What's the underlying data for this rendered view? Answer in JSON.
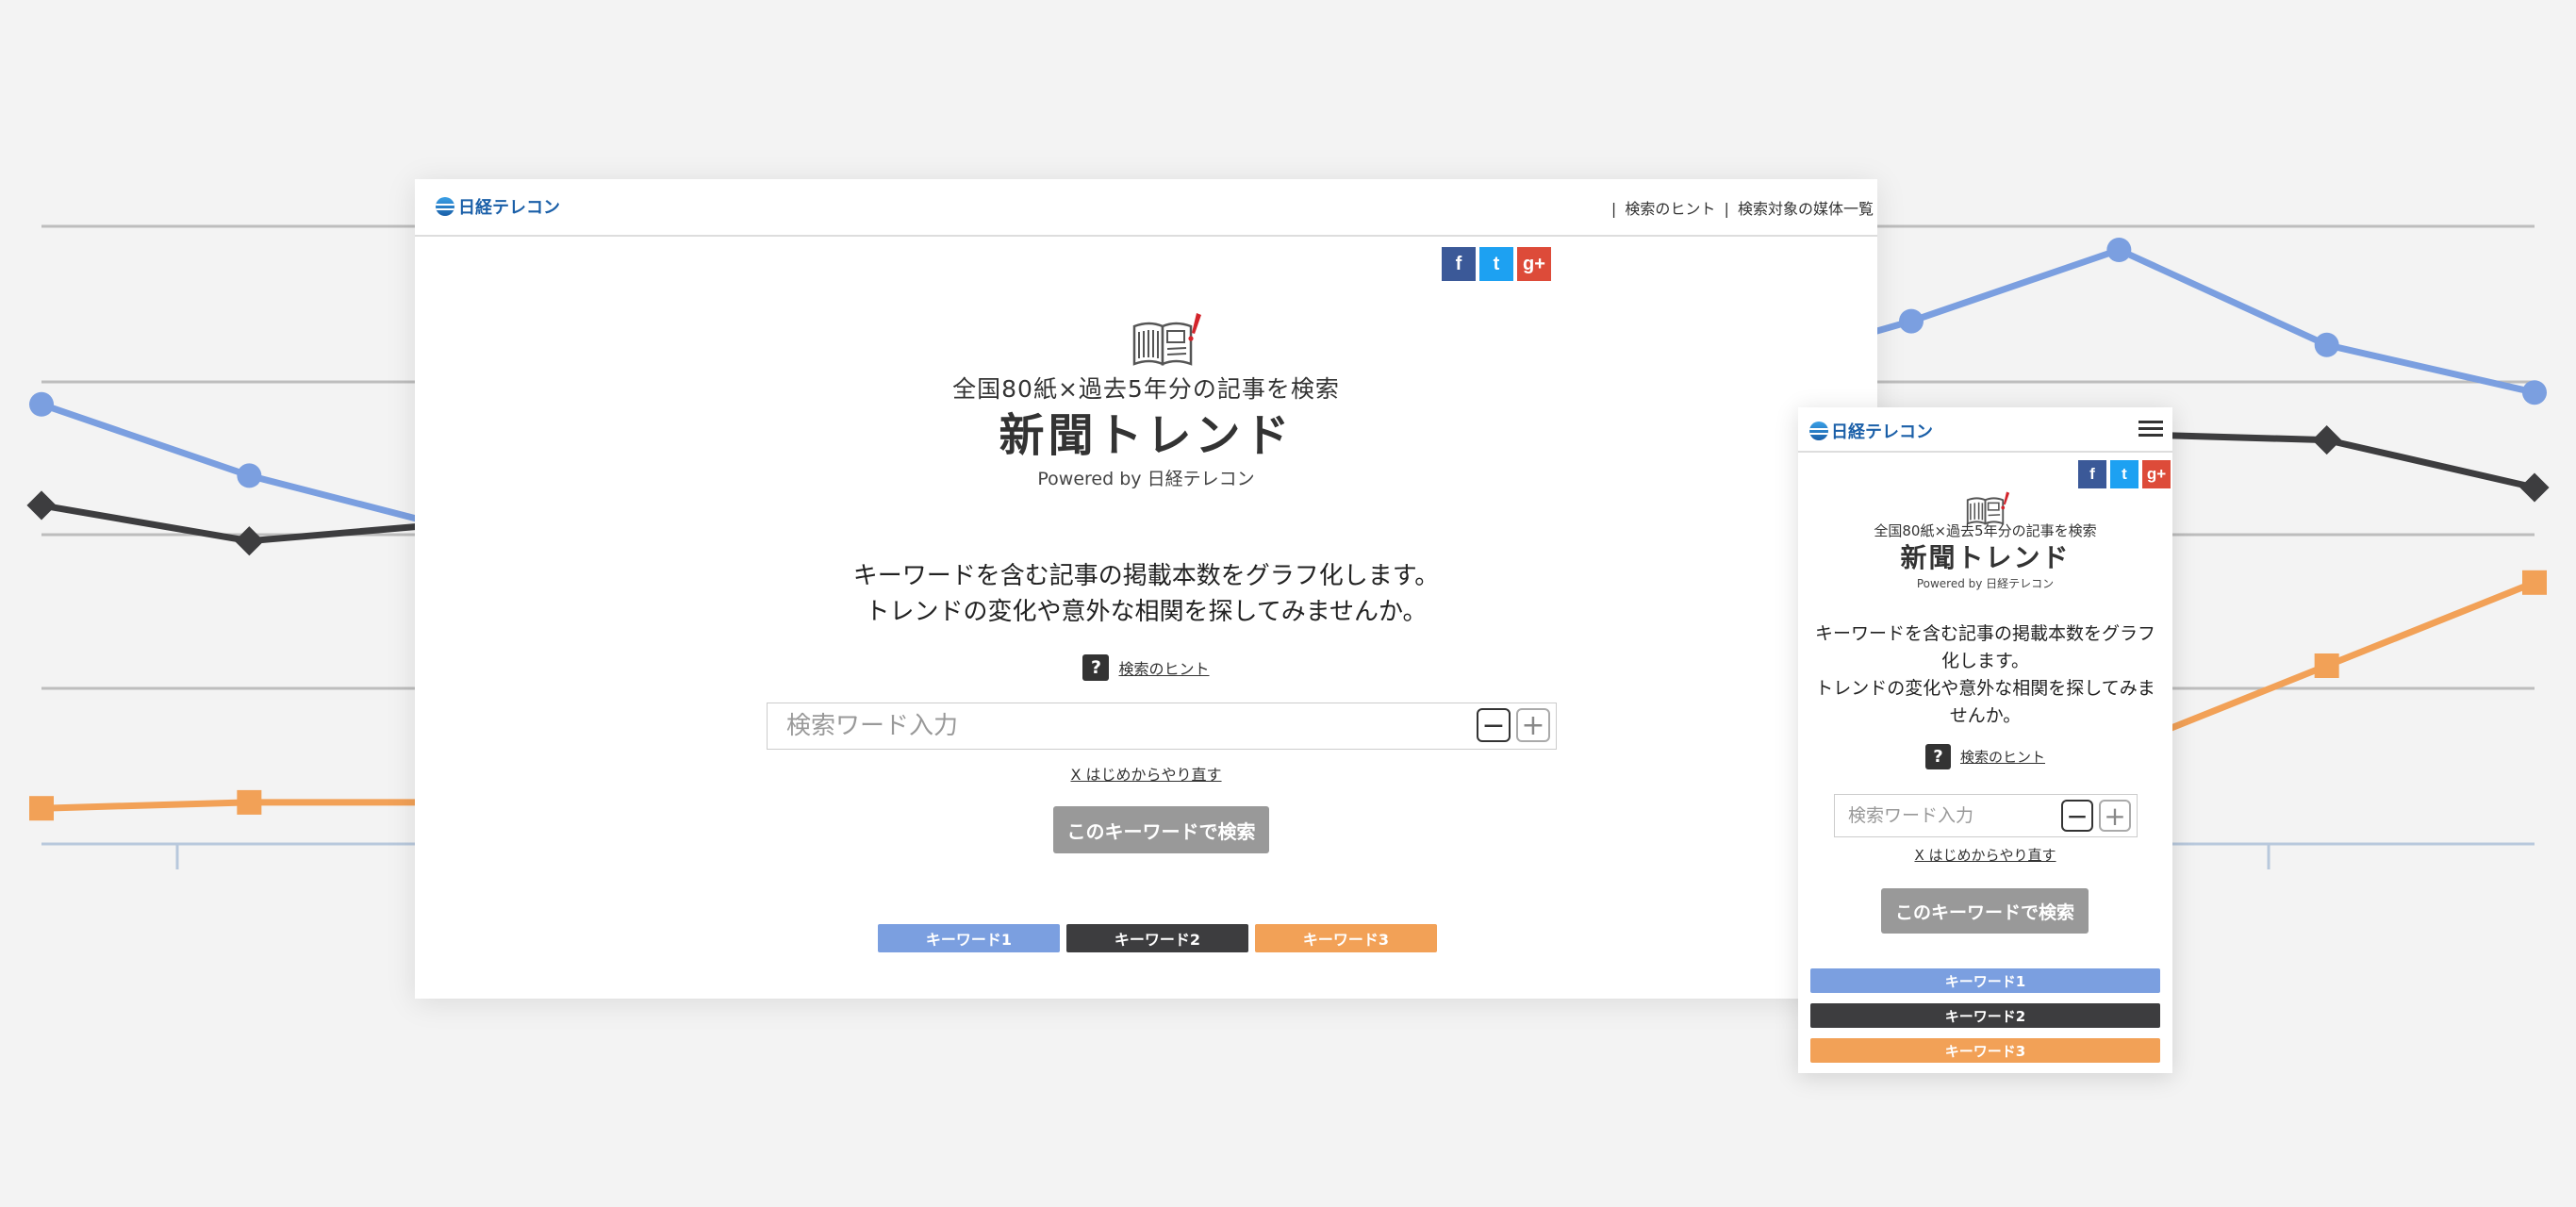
{
  "colors": {
    "keyword1": "#7b9fe0",
    "keyword2": "#3d3d3f",
    "keyword3": "#f2a157",
    "facebook": "#3b5998",
    "twitter": "#1da1f2",
    "googleplus": "#dd4b39",
    "search_button": "#999999"
  },
  "chart_data": {
    "type": "line",
    "grid": true,
    "series": [
      {
        "values": [
          74,
          62,
          53,
          60,
          66,
          70,
          73,
          75,
          78,
          88,
          100,
          84,
          76
        ]
      },
      {
        "values": [
          57,
          51,
          54,
          54,
          55,
          57,
          58,
          59,
          60,
          62,
          69,
          68,
          60
        ]
      },
      {
        "values": [
          6,
          7,
          7,
          5,
          6,
          7,
          8,
          9,
          10,
          12,
          16,
          30,
          44
        ]
      }
    ]
  },
  "desktop": {
    "logo": "日経テレコン",
    "header_links": [
      "|",
      "検索のヒント",
      "|",
      "検索対象の媒体一覧"
    ],
    "social": {
      "facebook": "f",
      "twitter": "t",
      "googleplus": "g+"
    },
    "subtitle": "全国80紙×過去5年分の記事を検索",
    "title": "新聞トレンド",
    "powered": "Powered by 日経テレコン",
    "lead_line1": "キーワードを含む記事の掲載本数をグラフ化します。",
    "lead_line2": "トレンドの変化や意外な相関を探してみませんか。",
    "hint_icon": "?",
    "hint_link": "検索のヒント",
    "search_placeholder": "検索ワード入力",
    "minus": "−",
    "plus": "+",
    "reset": "X はじめからやり直す",
    "search_button": "このキーワードで検索",
    "keywords": [
      "キーワード1",
      "キーワード2",
      "キーワード3"
    ]
  },
  "mobile": {
    "logo": "日経テレコン",
    "social": {
      "facebook": "f",
      "twitter": "t",
      "googleplus": "g+"
    },
    "subtitle": "全国80紙×過去5年分の記事を検索",
    "title": "新聞トレンド",
    "powered": "Powered by 日経テレコン",
    "lead_line1": "キーワードを含む記事の掲載本数をグラフ化します。",
    "lead_line2": "トレンドの変化や意外な相関を探してみませんか。",
    "hint_icon": "?",
    "hint_link": "検索のヒント",
    "search_placeholder": "検索ワード入力",
    "minus": "−",
    "plus": "+",
    "reset": "X はじめからやり直す",
    "search_button": "このキーワードで検索",
    "keywords": [
      "キーワード1",
      "キーワード2",
      "キーワード3"
    ]
  }
}
